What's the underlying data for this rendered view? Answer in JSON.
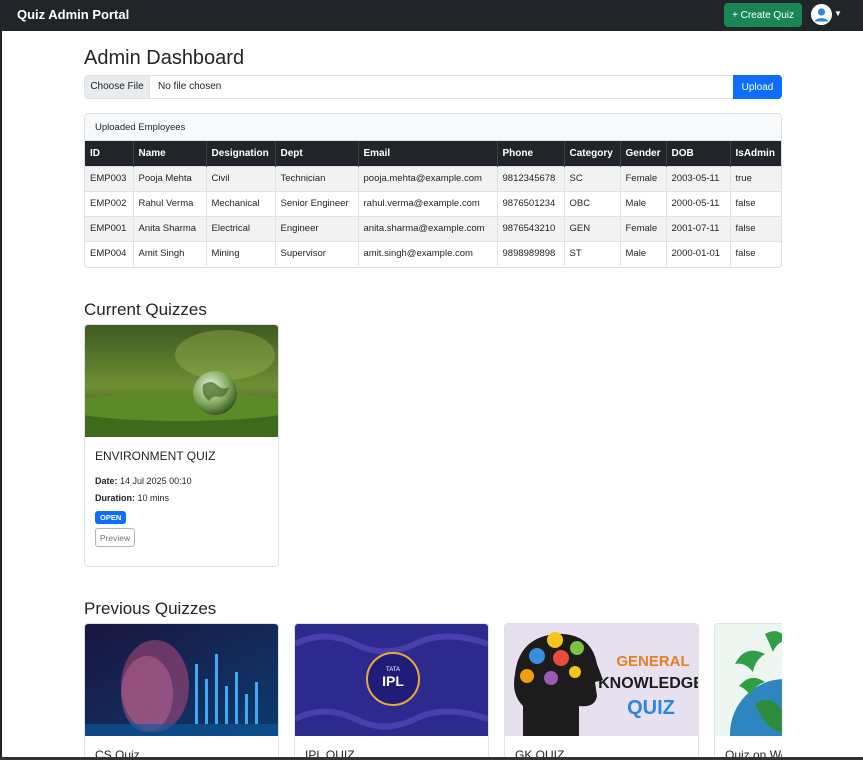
{
  "navbar": {
    "brand": "Quiz Admin Portal",
    "create_label": "+ Create Quiz",
    "avatar_icon": "user-avatar-icon",
    "caret_icon": "caret-down-icon"
  },
  "dashboard": {
    "title": "Admin Dashboard",
    "choose_file_label": "Choose File",
    "file_status": "No file chosen",
    "upload_label": "Upload"
  },
  "employees": {
    "header": "Uploaded Employees",
    "columns": [
      "ID",
      "Name",
      "Designation",
      "Dept",
      "Email",
      "Phone",
      "Category",
      "Gender",
      "DOB",
      "IsAdmin"
    ],
    "rows": [
      [
        "EMP003",
        "Pooja Mehta",
        "Civil",
        "Technician",
        "pooja.mehta@example.com",
        "9812345678",
        "SC",
        "Female",
        "2003-05-11",
        "true"
      ],
      [
        "EMP002",
        "Rahul Verma",
        "Mechanical",
        "Senior Engineer",
        "rahul.verma@example.com",
        "9876501234",
        "OBC",
        "Male",
        "2000-05-11",
        "false"
      ],
      [
        "EMP001",
        "Anita Sharma",
        "Electrical",
        "Engineer",
        "anita.sharma@example.com",
        "9876543210",
        "GEN",
        "Female",
        "2001-07-11",
        "false"
      ],
      [
        "EMP004",
        "Amit Singh",
        "Mining",
        "Supervisor",
        "amit.singh@example.com",
        "9898989898",
        "ST",
        "Male",
        "2000-01-01",
        "false"
      ]
    ]
  },
  "current": {
    "section_title": "Current Quizzes",
    "quiz": {
      "title": "ENVIRONMENT QUIZ",
      "date_label": "Date:",
      "date_value": "14 Jul 2025 00:10",
      "duration_label": "Duration:",
      "duration_value": "10 mins",
      "status_badge": "OPEN",
      "preview_label": "Preview"
    }
  },
  "previous": {
    "section_title": "Previous Quizzes",
    "quizzes": [
      {
        "title": "CS Quiz",
        "image_icon": "ai-head-image"
      },
      {
        "title": "IPL QUIZ",
        "image_icon": "ipl-logo-image",
        "image_text_top": "TATA",
        "image_text": "IPL"
      },
      {
        "title": "GK QUIZ",
        "image_icon": "gk-head-gears-image",
        "image_lines": [
          "GENERAL",
          "KNOWLEDGE",
          "QUIZ"
        ]
      },
      {
        "title": "Quiz on World Environment Day",
        "image_icon": "earth-leaves-image"
      }
    ]
  },
  "colors": {
    "navbar": "#212529",
    "success": "#198754",
    "primary": "#0d6efd"
  }
}
